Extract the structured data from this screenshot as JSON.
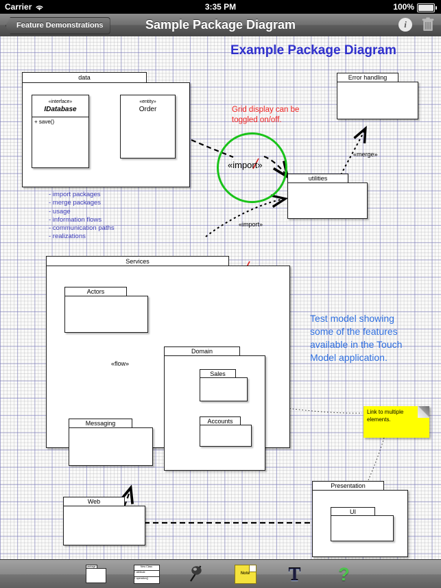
{
  "status_bar": {
    "carrier": "Carrier",
    "wifi_icon": "wifi-icon",
    "time": "3:35 PM",
    "battery_percent": "100%",
    "battery_icon": "battery-full-icon"
  },
  "nav_bar": {
    "back_label": "Feature Demonstrations",
    "title": "Sample Package Diagram",
    "info_label": "i",
    "info_icon": "info-icon",
    "trash_icon": "trash-icon"
  },
  "canvas": {
    "heading": "Example Package Diagram",
    "red_note": "Grid display can be\ntoggled on/off.",
    "red_note_line1": "Grid display can be",
    "red_note_line2": "toggled on/off.",
    "blue_note": "Test model showing some of the features available in the Touch Model application.",
    "blue_note_lines": [
      "Test model showing",
      "some of the features",
      "available in the Touch",
      "Model application."
    ],
    "feature_list": [
      "- import packages",
      "- merge packages",
      "- usage",
      "- information flows",
      "- communication paths",
      "- realizations"
    ],
    "sticky_note": {
      "text": "Link to multiple elements.",
      "line1": "Link to multiple",
      "line2": "elements.",
      "color": "#ffff00"
    },
    "packages": [
      {
        "id": "data",
        "name": "data"
      },
      {
        "id": "error_handling",
        "name": "Error handling"
      },
      {
        "id": "utilities",
        "name": "utilities"
      },
      {
        "id": "services",
        "name": "Services"
      },
      {
        "id": "actors",
        "name": "Actors"
      },
      {
        "id": "messaging",
        "name": "Messaging"
      },
      {
        "id": "domain",
        "name": "Domain"
      },
      {
        "id": "sales",
        "name": "Sales"
      },
      {
        "id": "accounts",
        "name": "Accounts"
      },
      {
        "id": "web",
        "name": "Web"
      },
      {
        "id": "presentation",
        "name": "Presentation"
      },
      {
        "id": "ui",
        "name": "UI"
      }
    ],
    "classes": [
      {
        "id": "idatabase",
        "stereotype": "«interface»",
        "name": "IDatabase",
        "attribute": "+ save()"
      },
      {
        "id": "order",
        "stereotype": "«entity»",
        "name": "Order",
        "attribute": ""
      }
    ],
    "relationships": [
      {
        "id": "import_circle",
        "label": "«import»",
        "accent_color": "#19c219"
      },
      {
        "id": "import_lower",
        "label": "«import»"
      },
      {
        "id": "merge",
        "label": "«merge»"
      },
      {
        "id": "flow",
        "label": "«flow»"
      }
    ]
  },
  "toolbar": {
    "items": [
      {
        "id": "package-tool",
        "icon": "package-icon",
        "label": "package"
      },
      {
        "id": "class-tool",
        "icon": "class-icon",
        "label": "New Class",
        "attr": "+ attribute",
        "op": "+ operation()"
      },
      {
        "id": "connector-tool",
        "icon": "pin-connector-icon",
        "label": ""
      },
      {
        "id": "note-tool",
        "icon": "note-icon",
        "label": "Note"
      },
      {
        "id": "text-tool",
        "icon": "text-icon",
        "label": "T"
      },
      {
        "id": "help-tool",
        "icon": "help-icon",
        "label": "?"
      }
    ]
  }
}
